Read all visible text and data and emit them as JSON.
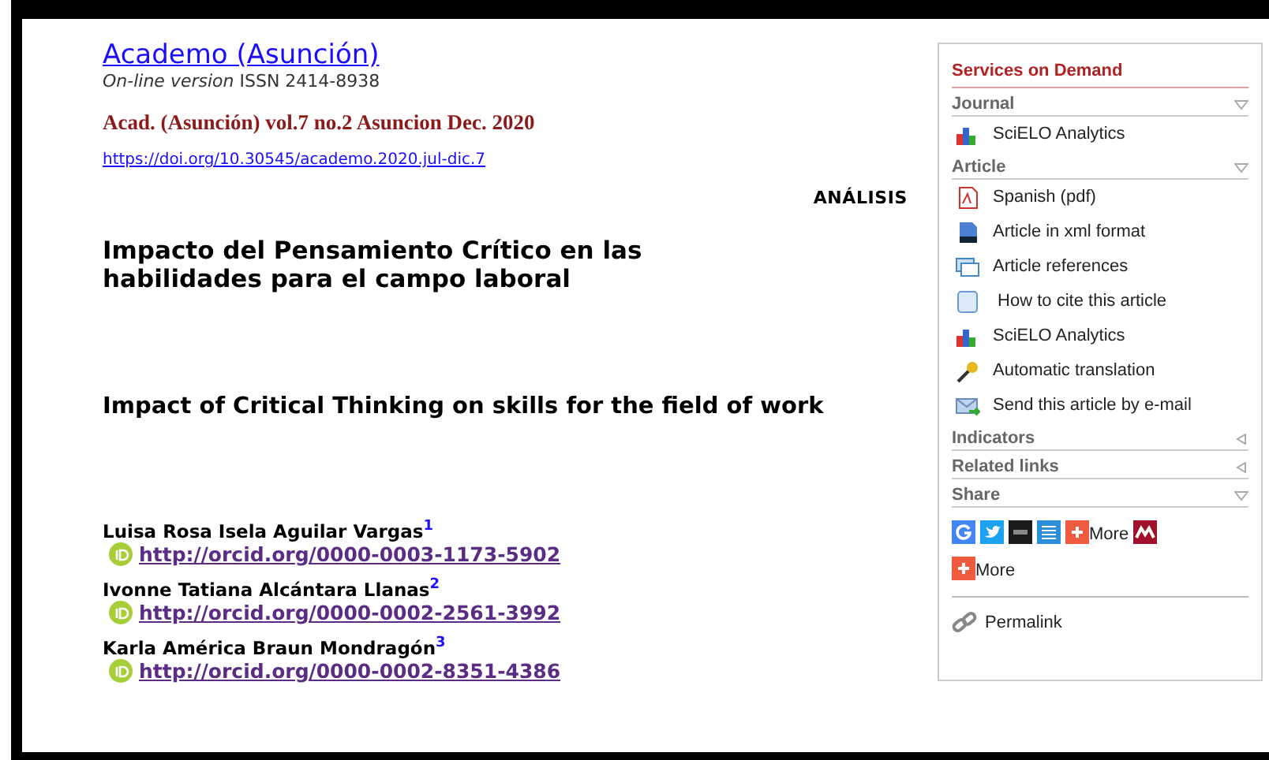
{
  "journal": {
    "title": "Academo (Asunción)",
    "version_label": "On-line version",
    "issn": "ISSN 2414-8938",
    "citation": "Acad. (Asunción) vol.7 no.2 Asuncion Dec. 2020",
    "doi": "https://doi.org/10.30545/academo.2020.jul-dic.7"
  },
  "article": {
    "section": "ANÁLISIS",
    "title_es": "Impacto del Pensamiento Crítico en las habilidades para el campo laboral",
    "title_en": "Impact of Critical Thinking on skills for the field of work",
    "authors": [
      {
        "name": "Luisa Rosa Isela Aguilar Vargas",
        "note": "1",
        "orcid": "http://orcid.org/0000-0003-1173-5902"
      },
      {
        "name": "Ivonne Tatiana Alcántara Llanas",
        "note": "2",
        "orcid": "http://orcid.org/0000-0002-2561-3992"
      },
      {
        "name": "Karla América Braun Mondragón",
        "note": "3",
        "orcid": "http://orcid.org/0000-0002-8351-4386"
      }
    ]
  },
  "sidebar": {
    "title": "Services on Demand",
    "sections": [
      {
        "label": "Journal",
        "expanded": true,
        "items": [
          {
            "kind": "bars",
            "label": "SciELO Analytics"
          }
        ]
      },
      {
        "label": "Article",
        "expanded": true,
        "items": [
          {
            "kind": "pdf",
            "label": "Spanish (pdf)"
          },
          {
            "kind": "xml",
            "label": "Article in xml format"
          },
          {
            "kind": "refs",
            "label": "Article references"
          },
          {
            "kind": "cite",
            "label": " How to cite this article"
          },
          {
            "kind": "bars",
            "label": "SciELO Analytics"
          },
          {
            "kind": "key",
            "label": "Automatic translation"
          },
          {
            "kind": "mail",
            "label": "Send this article by e-mail"
          }
        ]
      },
      {
        "label": "Indicators",
        "expanded": false
      },
      {
        "label": "Related links",
        "expanded": false
      },
      {
        "label": "Share",
        "expanded": true,
        "share_rows": [
          [
            {
              "kind": "google"
            },
            {
              "kind": "twitter"
            },
            {
              "kind": "digg"
            },
            {
              "kind": "list"
            },
            {
              "kind": "plus",
              "label": "More"
            },
            {
              "kind": "mendeley"
            }
          ],
          [
            {
              "kind": "plus",
              "label": "More"
            }
          ]
        ]
      }
    ],
    "permalink": "Permalink"
  }
}
